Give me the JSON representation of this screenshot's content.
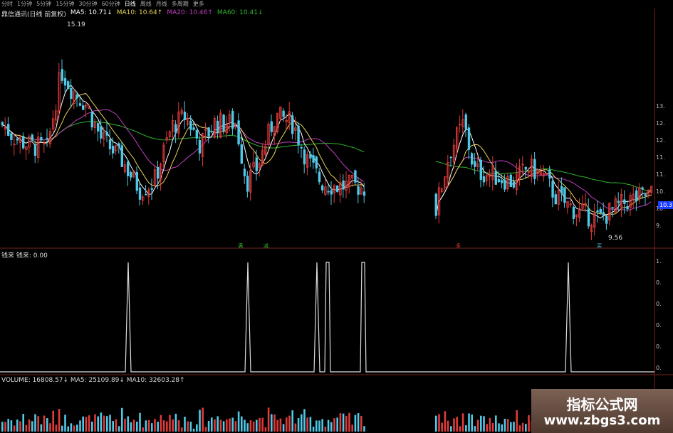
{
  "toolbar": {
    "items": [
      "分时",
      "1分钟",
      "5分钟",
      "15分钟",
      "30分钟",
      "60分钟",
      "日线",
      "周线",
      "月线",
      "多周期",
      "更多"
    ],
    "active_index": 6
  },
  "price_panel": {
    "stock_label": "鼎信通讯(日线 前复权)",
    "ma5": "MA5: 10.71↓",
    "ma10": "MA10: 10.64↑",
    "ma20": "MA20: 10.46↑",
    "ma60": "MA60: 10.41↓",
    "high_annotation": "15.19",
    "low_annotation": "9.56",
    "axis_ticks": [
      "13.",
      "12.",
      "12.",
      "11.",
      "11.",
      "10.",
      "10.",
      "9."
    ],
    "last_price_tag": "10.3",
    "markers": [
      "满",
      "减",
      "多",
      "买"
    ]
  },
  "signal_panel": {
    "label": "钱来 钱来: 0.00",
    "axis_ticks": [
      "1.",
      "0.",
      "0.",
      "0.",
      "0.",
      "0."
    ]
  },
  "volume_panel": {
    "label": "VOLUME: 16808.57↓ MA5: 25109.89↓ MA10: 32603.28↑"
  },
  "colors": {
    "up": "#e23a3a",
    "down": "#4ec9e6",
    "ma5": "#ffffff",
    "ma10": "#e8d25a",
    "ma20": "#c040c0",
    "ma60": "#2fb52f",
    "signal": "#dddddd",
    "panel_border": "#7a1f1f"
  },
  "watermark": {
    "line1": "指标公式网",
    "line2": "www.zbgs3.com"
  },
  "chart_data": {
    "type": "candlestick",
    "price_high": 15.19,
    "price_low": 9.56,
    "ma_values": {
      "MA5": 10.71,
      "MA10": 10.64,
      "MA20": 10.46,
      "MA60": 10.41
    },
    "signal_value": 0.0,
    "signal_spikes_count": 6,
    "volume": {
      "VOLUME": 16808.57,
      "MA5": 25109.89,
      "MA10": 32603.28
    }
  }
}
